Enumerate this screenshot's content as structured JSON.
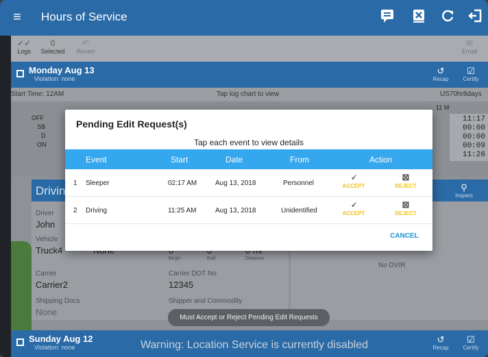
{
  "appbar": {
    "title": "Hours of Service",
    "icons": [
      "menu-icon",
      "message-icon",
      "delete-x-icon",
      "refresh-icon",
      "logout-icon"
    ]
  },
  "toolbar": {
    "logs_label": "Logs",
    "selected_count": "0",
    "selected_label": "Selected",
    "revert_label": "Revert",
    "email_label": "Email"
  },
  "day": {
    "title": "Monday Aug 13",
    "violation": "Violation: none",
    "recap_label": "Recap",
    "certify_label": "Certify",
    "start_time": "Start Time: 12AM",
    "tap_hint": "Tap log chart to view",
    "cycle": "US70hr8days",
    "chart_rows": [
      "OFF",
      "SB",
      "D",
      "ON"
    ],
    "chart_hour_label": "11  M",
    "chart_hours": [
      "11:17",
      "00:00",
      "00:00",
      "00:09",
      "11:26"
    ]
  },
  "details": {
    "head": "Driving",
    "driver_label": "Driver",
    "driver_value": "John",
    "vehicle_label": "Vehicle",
    "vehicle_value": "Truck4",
    "trailer_value": "None",
    "begin_value": "0",
    "begin_label": "Begin",
    "end_value": "0",
    "end_label": "End",
    "distance_value": "0 mi",
    "distance_label": "Distance",
    "carrier_label": "Carrier",
    "carrier_value": "Carrier2",
    "dot_label": "Carrier DOT No",
    "dot_value": "12345",
    "shipping_label": "Shipping Docs",
    "shipping_value": "None",
    "shipper_label": "Shipper and Commodity",
    "inspect_label": "Inspect",
    "dvir_value": "No DVIR"
  },
  "next_day": {
    "title": "Sunday Aug 12",
    "violation": "Violation: none",
    "recap_label": "Recap",
    "certify_label": "Certify"
  },
  "warning": "Warning: Location Service is currently disabled",
  "toast": "Must Accept or Reject Pending Edit Requests",
  "dialog": {
    "title": "Pending Edit Request(s)",
    "subtitle": "Tap each event to view details",
    "columns": {
      "event": "Event",
      "start": "Start",
      "date": "Date",
      "from": "From",
      "action": "Action"
    },
    "rows": [
      {
        "num": "1",
        "event": "Sleeper",
        "start": "02:17 AM",
        "date": "Aug 13, 2018",
        "from": "Personnel",
        "accept": "ACCEPT",
        "reject": "REJECT"
      },
      {
        "num": "2",
        "event": "Driving",
        "start": "11:25 AM",
        "date": "Aug 13, 2018",
        "from": "Unidentified",
        "accept": "ACCEPT",
        "reject": "REJECT"
      }
    ],
    "cancel": "CANCEL"
  },
  "colors": {
    "appbar": "#2a6aa6",
    "table_header": "#35a7ef",
    "accept_reject": "#f0c419",
    "cancel": "#1a8fd6"
  }
}
